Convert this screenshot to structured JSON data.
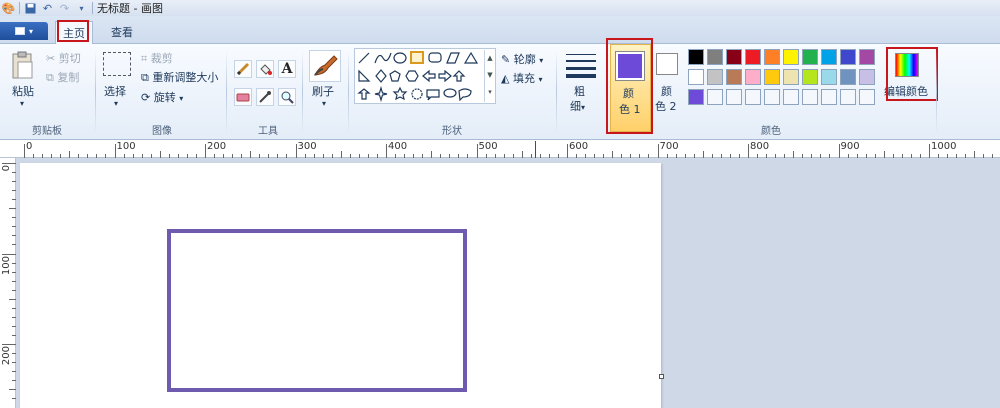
{
  "title_bar": {
    "title": "无标题 - 画图",
    "icons": [
      "paint-app-icon",
      "save-icon",
      "undo-icon",
      "redo-icon",
      "customize-arrow-icon"
    ]
  },
  "tabs": {
    "file_icon": "menu-icon",
    "home": "主页",
    "view": "查看"
  },
  "clipboard": {
    "paste": "粘贴",
    "cut": "剪切",
    "copy": "复制",
    "group": "剪贴板"
  },
  "image": {
    "select": "选择",
    "crop": "裁剪",
    "resize": "重新调整大小",
    "rotate": "旋转",
    "group": "图像"
  },
  "tools": {
    "group": "工具",
    "items": [
      "pencil-icon",
      "fill-icon",
      "text-icon",
      "eraser-icon",
      "color-picker-icon",
      "magnifier-icon"
    ]
  },
  "brushes": {
    "label": "刷子"
  },
  "shapes": {
    "outline": "轮廓",
    "fill": "填充",
    "group": "形状"
  },
  "size": {
    "label_line1": "粗",
    "label_line2": "细"
  },
  "colors": {
    "color1_line1": "颜",
    "color1_line2": "色 1",
    "color2_line1": "颜",
    "color2_line2": "色 2",
    "edit": "编辑颜色",
    "group": "颜色",
    "color1_value": "#6d4bd8",
    "color2_value": "#ffffff",
    "palette": [
      "#000000",
      "#7f7f7f",
      "#880015",
      "#ed1c24",
      "#ff7f27",
      "#fff200",
      "#22b14c",
      "#00a2e8",
      "#3f48cc",
      "#a349a4",
      "#ffffff",
      "#c3c3c3",
      "#b97a57",
      "#ffaec9",
      "#ffc90e",
      "#efe4b0",
      "#b5e61d",
      "#99d9ea",
      "#7092be",
      "#c8bfe7",
      "#6d4bd8"
    ]
  },
  "ruler": {
    "h_labels": [
      "0",
      "100",
      "200",
      "300",
      "400",
      "500",
      "600",
      "700",
      "800",
      "900",
      "1000"
    ],
    "v_labels": [
      "0",
      "100",
      "200"
    ]
  },
  "accent": {
    "highlight": "#c8161d",
    "shape_stroke": "#6e5bb0"
  }
}
